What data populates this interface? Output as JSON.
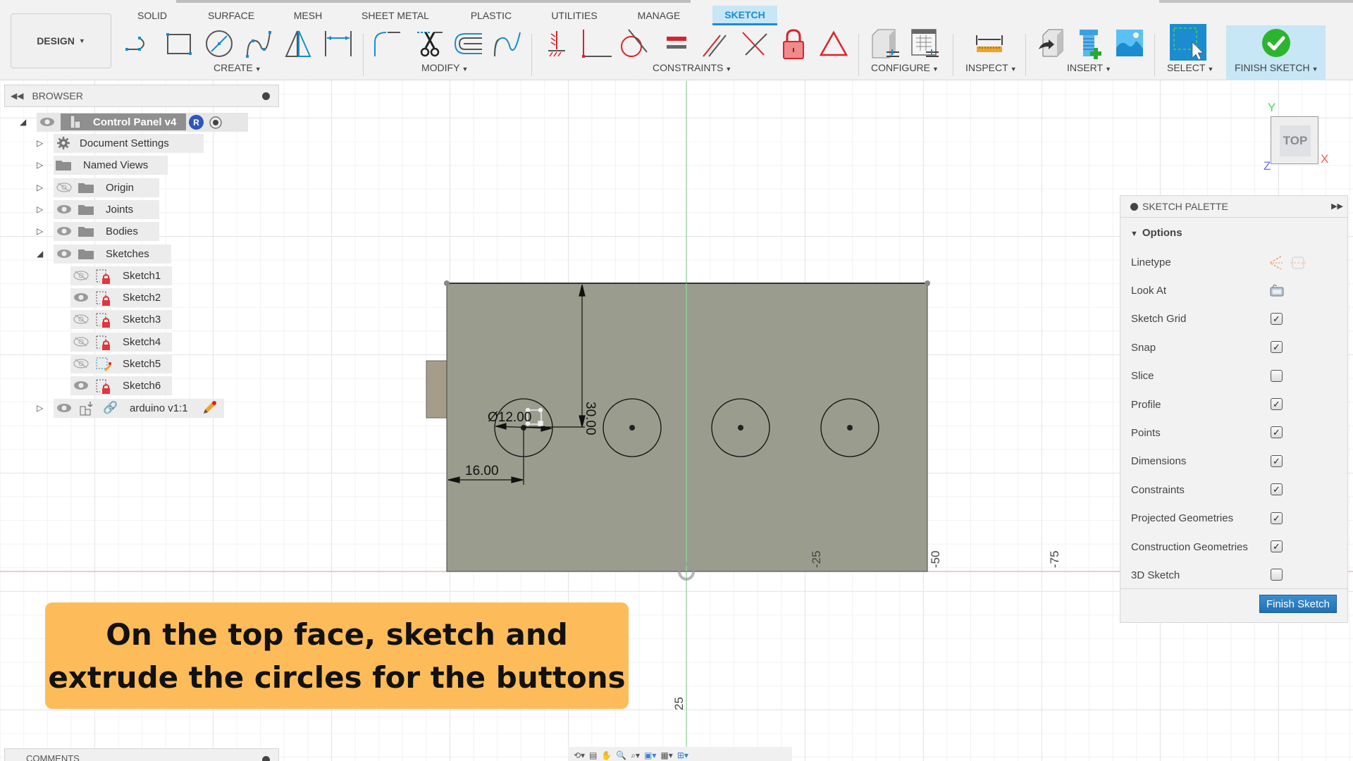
{
  "toolbar": {
    "workspace": "DESIGN",
    "tabs": [
      "SOLID",
      "SURFACE",
      "MESH",
      "SHEET METAL",
      "PLASTIC",
      "UTILITIES",
      "MANAGE",
      "SKETCH"
    ],
    "active_tab": "SKETCH",
    "groups": {
      "create": "CREATE",
      "modify": "MODIFY",
      "constraints": "CONSTRAINTS",
      "configure": "CONFIGURE",
      "inspect": "INSPECT",
      "insert": "INSERT",
      "select": "SELECT",
      "finish_sketch": "FINISH SKETCH"
    },
    "create_icons": [
      "line-icon",
      "rectangle-icon",
      "circle-icon",
      "spline-icon",
      "mirror-icon",
      "dimension-icon"
    ],
    "modify_icons": [
      "fillet-icon",
      "trim-icon",
      "offset-icon",
      "fit-curve-icon"
    ],
    "constraint_icons": [
      "horizontal-vertical-icon",
      "coincident-icon",
      "tangent-icon",
      "equal-icon",
      "parallel-icon",
      "perpendicular-icon",
      "fix-lock-icon",
      "symmetry-icon"
    ],
    "accent": "#1a8ccf"
  },
  "browser": {
    "title": "BROWSER",
    "root": {
      "label": "Control Panel v4",
      "badge": "R"
    },
    "items": [
      {
        "label": "Document Settings",
        "icon": "gear-icon",
        "eye": "none"
      },
      {
        "label": "Named Views",
        "icon": "folder-icon",
        "eye": "none"
      },
      {
        "label": "Origin",
        "icon": "folder-icon",
        "eye": "hidden"
      },
      {
        "label": "Joints",
        "icon": "folder-icon",
        "eye": "visible"
      },
      {
        "label": "Bodies",
        "icon": "folder-icon",
        "eye": "visible"
      },
      {
        "label": "Sketches",
        "icon": "folder-icon",
        "eye": "visible",
        "expanded": true
      }
    ],
    "sketches": [
      {
        "label": "Sketch1",
        "eye": "hidden"
      },
      {
        "label": "Sketch2",
        "eye": "visible"
      },
      {
        "label": "Sketch3",
        "eye": "hidden"
      },
      {
        "label": "Sketch4",
        "eye": "hidden"
      },
      {
        "label": "Sketch5",
        "eye": "hidden",
        "editing": true
      },
      {
        "label": "Sketch6",
        "eye": "visible"
      }
    ],
    "component": {
      "label": "arduino v1:1"
    }
  },
  "palette": {
    "title": "SKETCH PALETTE",
    "section": "Options",
    "options": [
      {
        "label": "Linetype",
        "type": "icons"
      },
      {
        "label": "Look At",
        "type": "icon"
      },
      {
        "label": "Sketch Grid",
        "type": "checkbox",
        "checked": true
      },
      {
        "label": "Snap",
        "type": "checkbox",
        "checked": true
      },
      {
        "label": "Slice",
        "type": "checkbox",
        "checked": false
      },
      {
        "label": "Profile",
        "type": "checkbox",
        "checked": true
      },
      {
        "label": "Points",
        "type": "checkbox",
        "checked": true
      },
      {
        "label": "Dimensions",
        "type": "checkbox",
        "checked": true
      },
      {
        "label": "Constraints",
        "type": "checkbox",
        "checked": true
      },
      {
        "label": "Projected Geometries",
        "type": "checkbox",
        "checked": true
      },
      {
        "label": "Construction Geometries",
        "type": "checkbox",
        "checked": true
      },
      {
        "label": "3D Sketch",
        "type": "checkbox",
        "checked": false
      }
    ],
    "finish_button": "Finish Sketch"
  },
  "viewcube": {
    "face": "TOP",
    "axes": {
      "y": "Y",
      "x": "X",
      "z": "Z"
    }
  },
  "sketch": {
    "dimensions": {
      "diameter": "Ø12.00",
      "horizontal": "16.00",
      "vertical": "30.00"
    },
    "axis_ticks": {
      "x": [
        "-25",
        "-50",
        "-75"
      ],
      "y": [
        "25"
      ]
    },
    "circle_count": 4
  },
  "callout": {
    "line1": "On the top face, sketch and",
    "line2": "extrude the circles for the buttons",
    "color": "#fdbc59"
  },
  "comments": {
    "title": "COMMENTS"
  }
}
